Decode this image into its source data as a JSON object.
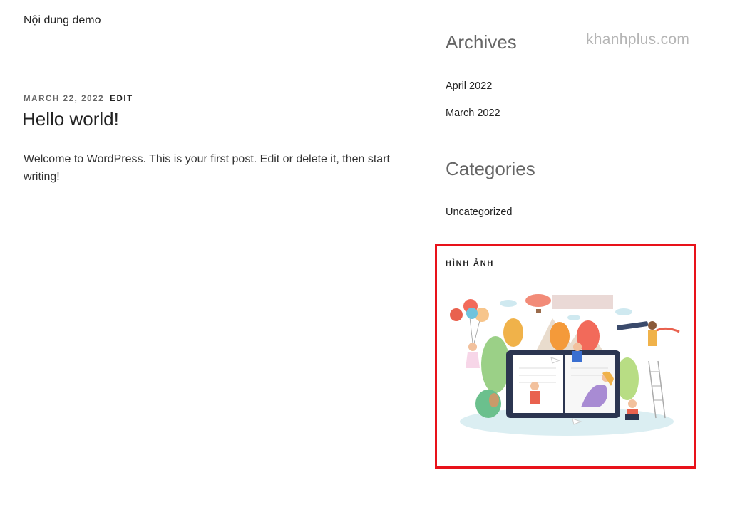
{
  "site": {
    "description": "Nội dung demo",
    "watermark": "khanhplus.com"
  },
  "post": {
    "date": "MARCH 22, 2022",
    "edit_label": "EDIT",
    "title": "Hello world!",
    "content": "Welcome to WordPress. This is your first post. Edit or delete it, then start writing!"
  },
  "sidebar": {
    "archives": {
      "title": "Archives",
      "items": [
        {
          "label": "April 2022"
        },
        {
          "label": "March 2022"
        }
      ]
    },
    "categories": {
      "title": "Categories",
      "items": [
        {
          "label": "Uncategorized"
        }
      ]
    },
    "image_widget": {
      "title": "HÌNH ẢNH",
      "highlight_color": "#e8121a"
    }
  }
}
